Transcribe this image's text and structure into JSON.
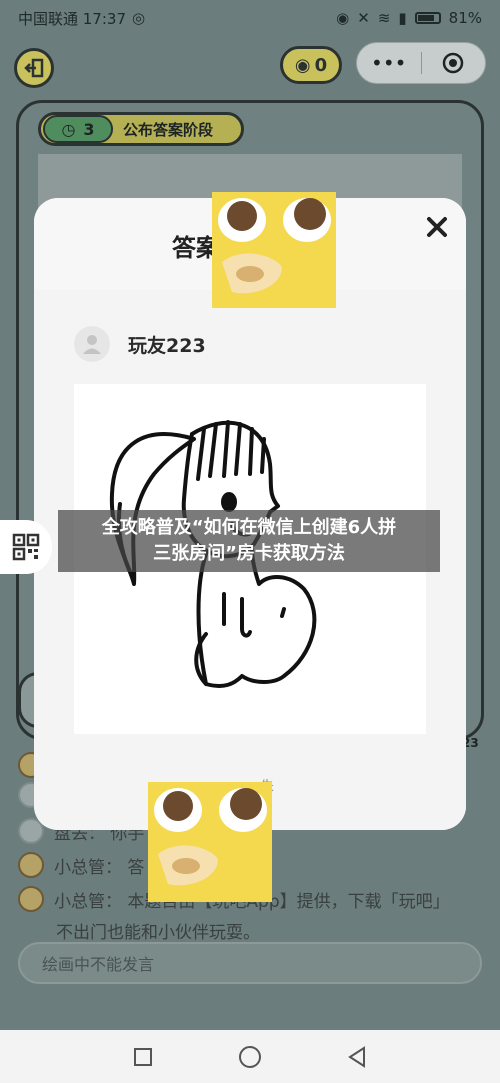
{
  "status_bar": {
    "carrier_time": "中国联通 17:37",
    "battery": "81%"
  },
  "toolbar": {
    "coin_count": "0",
    "capsule_more": "•••"
  },
  "phase": {
    "timer": "3",
    "label": "公布答案阶段"
  },
  "background": {
    "side_number": "23"
  },
  "modal": {
    "title": "答案",
    "player_name": "玩友223",
    "footer_fragment": "朱"
  },
  "chat": {
    "messages": [
      {
        "speaker": "盘丢",
        "text": "盘丢： 你手"
      },
      {
        "speaker": "小总管",
        "text": "小总管： 答"
      },
      {
        "speaker": "小总管",
        "text": "小总管： 本题目由【玩吧App】提供，下载「玩吧」"
      }
    ],
    "continuation": "不出门也能和小伙伴玩耍。",
    "input_placeholder": "绘画中不能发言"
  },
  "caption": {
    "line1": "全攻略普及“如何在微信上创建6人拼",
    "line2": "三张房间”房卡获取方法"
  },
  "colors": {
    "accent_yellow": "#c9c25c",
    "timer_green": "#4f8d5f",
    "dim_background": "#6b7d7c"
  }
}
